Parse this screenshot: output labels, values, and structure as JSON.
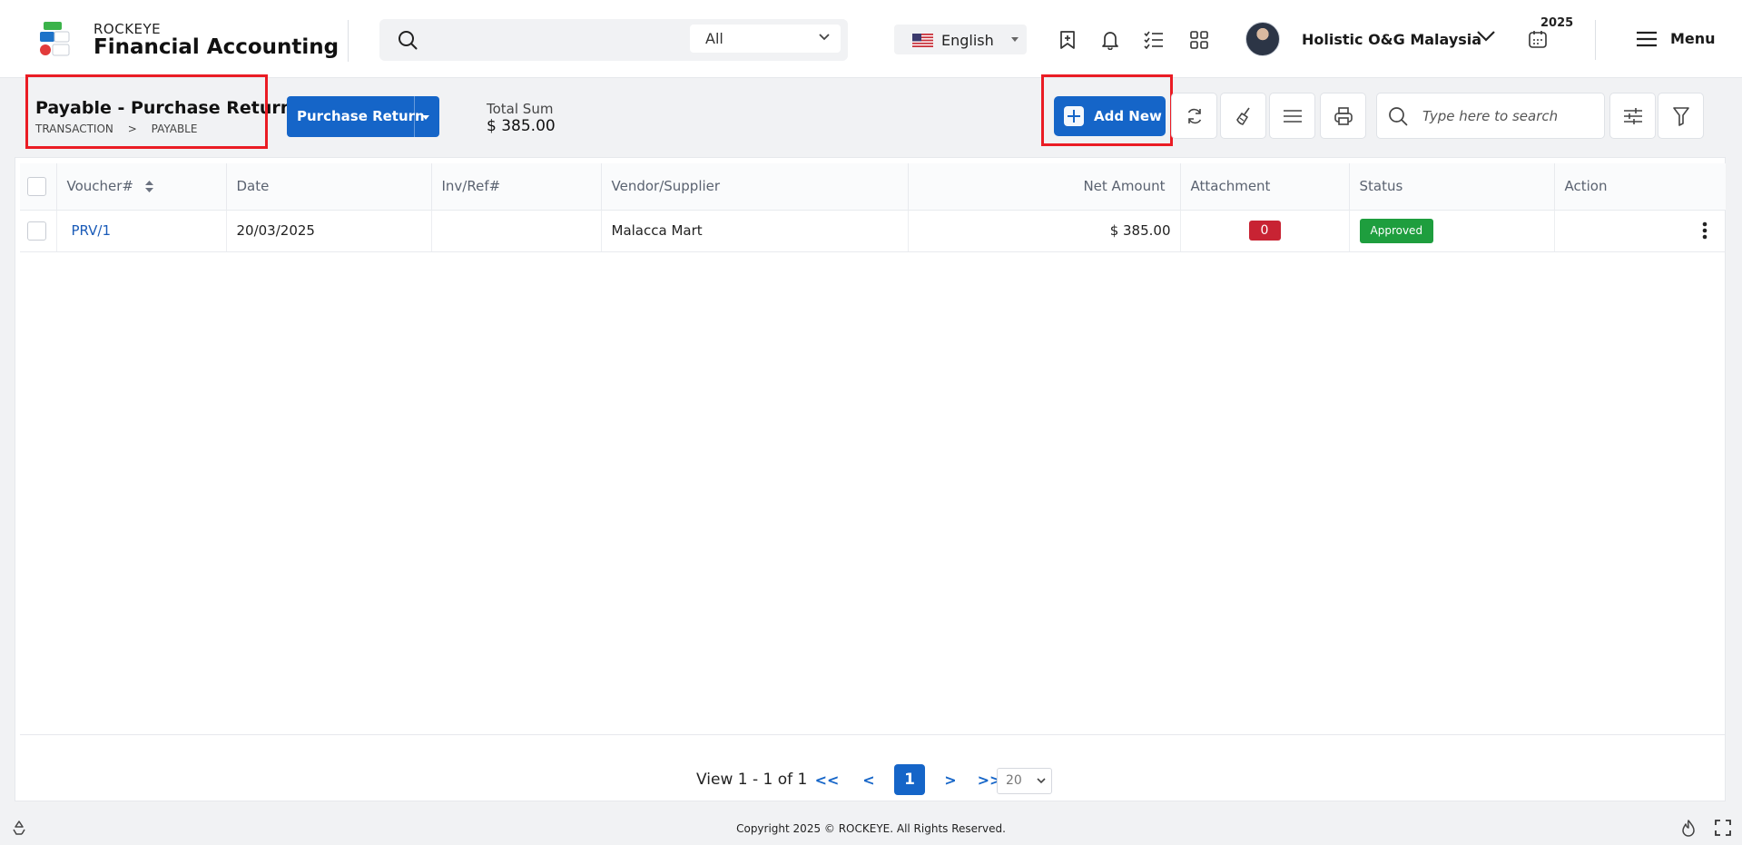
{
  "app": {
    "brand_small": "ROCKEYE",
    "brand_title": "Financial Accounting"
  },
  "search": {
    "scope": "All"
  },
  "language": {
    "label": "English"
  },
  "user": {
    "company": "Holistic O&G Malaysia",
    "year": "2025"
  },
  "menu": {
    "label": "Menu"
  },
  "page": {
    "title": "Payable - Purchase Return",
    "breadcrumb": [
      "TRANSACTION",
      ">",
      "PAYABLE"
    ],
    "type_button": "Purchase Return",
    "total_label": "Total Sum",
    "total_value": "$ 385.00",
    "add_new_label": "Add New",
    "search_placeholder": "Type here to search"
  },
  "table": {
    "columns": [
      "Voucher#",
      "Date",
      "Inv/Ref#",
      "Vendor/Supplier",
      "Net Amount",
      "Attachment",
      "Status",
      "Action"
    ],
    "rows": [
      {
        "voucher": "PRV/1",
        "date": "20/03/2025",
        "inv_ref": "",
        "vendor": "Malacca Mart",
        "net_amount": "$ 385.00",
        "attachment": "0",
        "status": "Approved"
      }
    ]
  },
  "pagination": {
    "summary": "View 1 - 1 of 1",
    "first": "<<",
    "prev": "<",
    "current": "1",
    "next": ">",
    "last": ">>",
    "page_size": "20"
  },
  "footer": {
    "copyright": "Copyright 2025 © ROCKEYE. All Rights Reserved."
  },
  "colors": {
    "primary": "#1565c8",
    "highlight": "#ea1c24",
    "approved": "#1e9e3e",
    "attachment_badge": "#c82333"
  }
}
